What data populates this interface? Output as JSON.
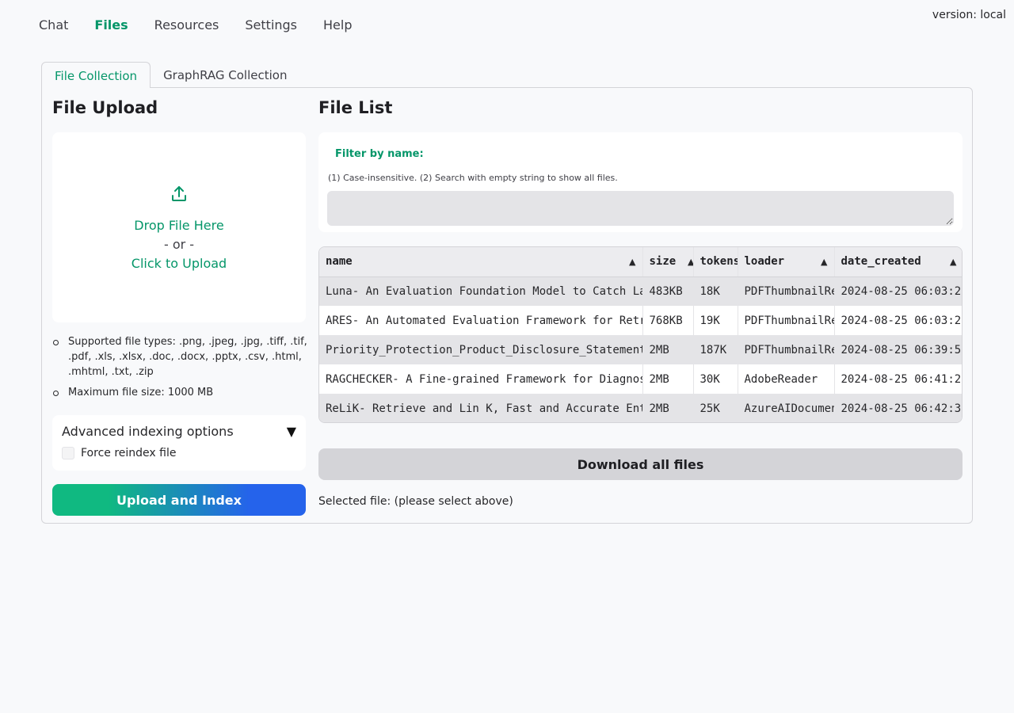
{
  "version_label": "version: local",
  "nav": {
    "items": [
      {
        "label": "Chat"
      },
      {
        "label": "Files"
      },
      {
        "label": "Resources"
      },
      {
        "label": "Settings"
      },
      {
        "label": "Help"
      }
    ],
    "active": "Files"
  },
  "subtabs": [
    {
      "label": "File Collection"
    },
    {
      "label": "GraphRAG Collection"
    }
  ],
  "upload": {
    "title": "File Upload",
    "icon": "upload-icon",
    "drop_text": "Drop File Here",
    "or_text": "- or -",
    "click_text": "Click to Upload",
    "supported_types": "Supported file types: .png, .jpeg, .jpg, .tiff, .tif, .pdf, .xls, .xlsx, .doc, .docx, .pptx, .csv, .html, .mhtml, .txt, .zip",
    "max_size": "Maximum file size: 1000 MB",
    "advanced_title": "Advanced indexing options",
    "force_reindex_label": "Force reindex file",
    "force_reindex_checked": false,
    "upload_button": "Upload and Index"
  },
  "file_list": {
    "title": "File List",
    "filter_label": "Filter by name:",
    "filter_hint": "(1) Case-insensitive. (2) Search with empty string to show all files.",
    "filter_value": "",
    "columns": [
      "name",
      "size",
      "tokens",
      "loader",
      "date_created"
    ],
    "rows": [
      {
        "name": "Luna- An Evaluation Foundation Model to Catch La",
        "size": "483KB",
        "tokens": "18K",
        "loader": "PDFThumbnailRe",
        "date_created": "2024-08-25 06:03:2"
      },
      {
        "name": "ARES- An Automated Evaluation Framework for Retr",
        "size": "768KB",
        "tokens": "19K",
        "loader": "PDFThumbnailRe",
        "date_created": "2024-08-25 06:03:2"
      },
      {
        "name": "Priority_Protection_Product_Disclosure_Statement",
        "size": "2MB",
        "tokens": "187K",
        "loader": "PDFThumbnailRe",
        "date_created": "2024-08-25 06:39:5"
      },
      {
        "name": "RAGCHECKER- A Fine-grained Framework for Diagnos",
        "size": "2MB",
        "tokens": "30K",
        "loader": "AdobeReader",
        "date_created": "2024-08-25 06:41:2"
      },
      {
        "name": "ReLiK- Retrieve and Lin K, Fast and Accurate Ent",
        "size": "2MB",
        "tokens": "25K",
        "loader": "AzureAIDocumen",
        "date_created": "2024-08-25 06:42:3"
      }
    ],
    "download_button": "Download all files",
    "selected_text": "Selected file: (please select above)"
  },
  "colors": {
    "accent_green": "#059669",
    "gradient_start": "#10b981",
    "gradient_end": "#2563eb"
  }
}
